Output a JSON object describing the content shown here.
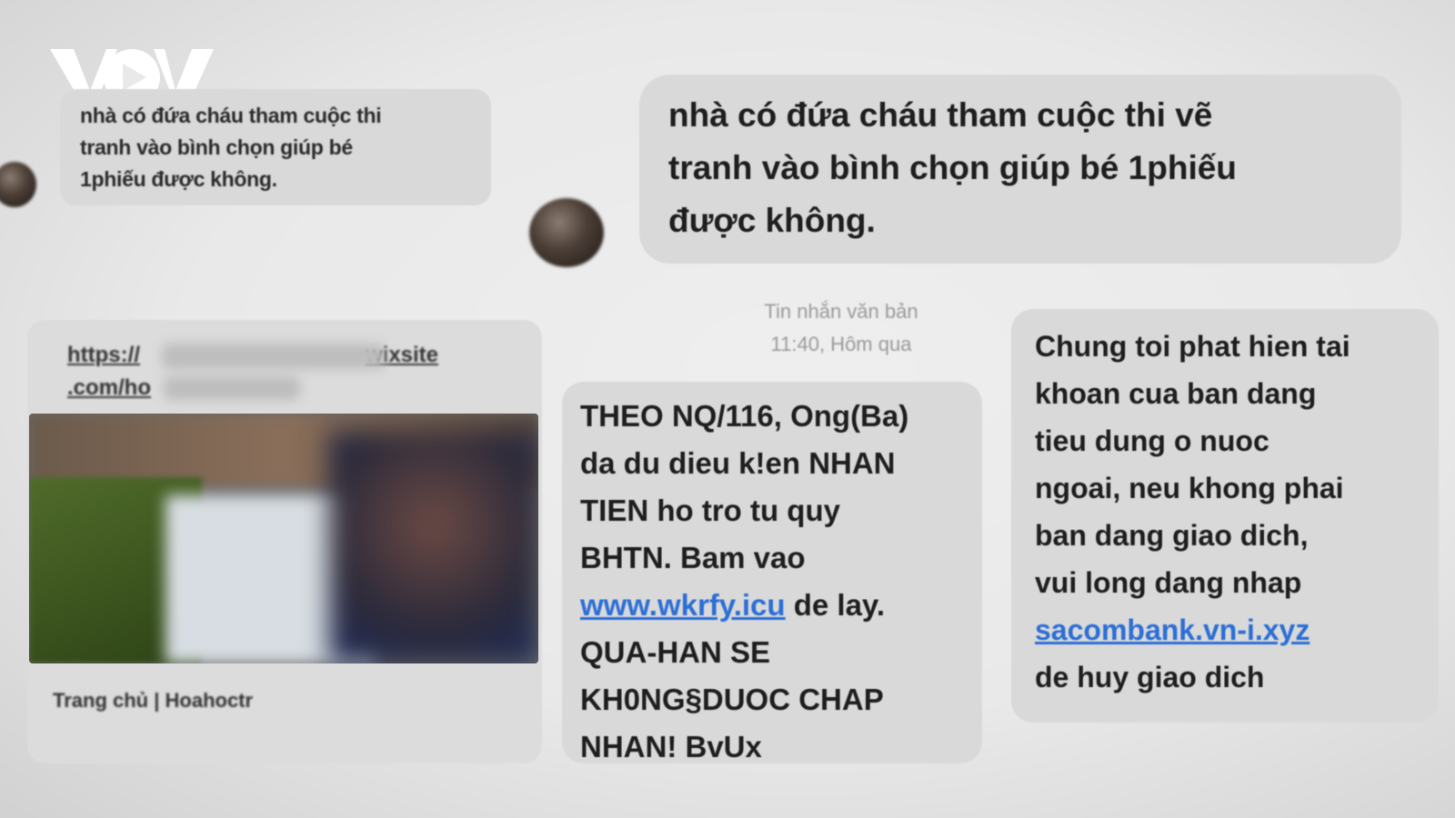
{
  "brand": {
    "logo_text": "VOV"
  },
  "left_message": {
    "text": "nhà có đứa cháu tham cuộc thi\ntranh vào bình chọn giúp bé\n1phiếu được không."
  },
  "main_message": {
    "text": "nhà có đứa cháu tham cuộc thi vẽ\ntranh vào bình chọn giúp bé 1phiếu\nđược không."
  },
  "link_preview": {
    "url_line1": "https://",
    "url_line1_end": "wixsite",
    "url_line2": ".com/ho",
    "caption": "Trang chủ | Hoahoctr"
  },
  "sms_header": {
    "type_label": "Tin nhắn văn bản",
    "timestamp": "11:40, Hôm qua"
  },
  "sms_1": {
    "text_before": "THEO NQ/116, Ong(Ba)\nda du dieu k!en NHAN\nTIEN ho tro tu quy\nBHTN. Bam vao\n",
    "link": "www.wkrfy.icu",
    "text_after": " de lay.\nQUA-HAN SE\nKH0NG§DUOC CHAP\nNHAN! BvUx"
  },
  "sms_2": {
    "text_before": "Chung toi phat hien tai\nkhoan cua ban dang\ntieu dung o nuoc\nngoai, neu khong phai\nban dang giao dich,\nvui long dang nhap\n",
    "link": "sacombank.vn-i.xyz",
    "text_after": "\nde huy giao dich"
  },
  "colors": {
    "background": "#e9e9e9",
    "bubble": "#d9d9d9",
    "link": "#2c6fd6",
    "meta_text": "#9a9a9a"
  }
}
